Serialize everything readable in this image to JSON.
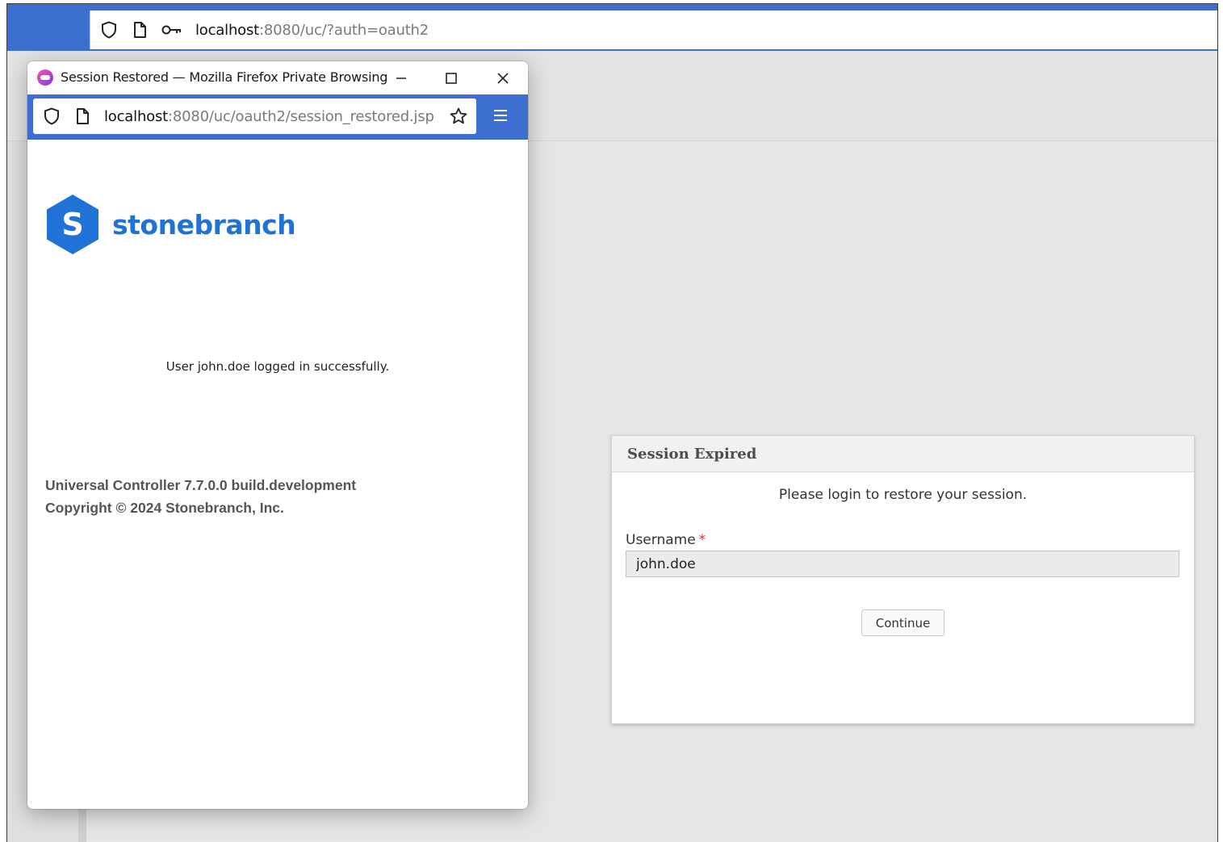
{
  "outer_browser": {
    "url_host": "localhost",
    "url_rest": ":8080/uc/?auth=oauth2",
    "icons": [
      "shield-icon",
      "page-icon",
      "key-icon"
    ]
  },
  "session_panel": {
    "title": "Session Expired",
    "message": "Please login to restore your session.",
    "username_label": "Username",
    "required_marker": "*",
    "username_value": "john.doe",
    "continue_label": "Continue"
  },
  "popup": {
    "title": "Session Restored — Mozilla Firefox Private Browsing",
    "url_host": "localhost",
    "url_rest": ":8080/uc/oauth2/session_restored.jsp",
    "brand": "stonebranch",
    "logo_letter": "S",
    "login_message": "User john.doe logged in successfully.",
    "footer_version": "Universal Controller 7.7.0.0 build.development",
    "footer_copyright": "Copyright © 2024 Stonebranch, Inc."
  },
  "colors": {
    "firefox_blue": "#3c6fd0",
    "brand_blue": "#1f73d6",
    "required_red": "#dd3333"
  }
}
